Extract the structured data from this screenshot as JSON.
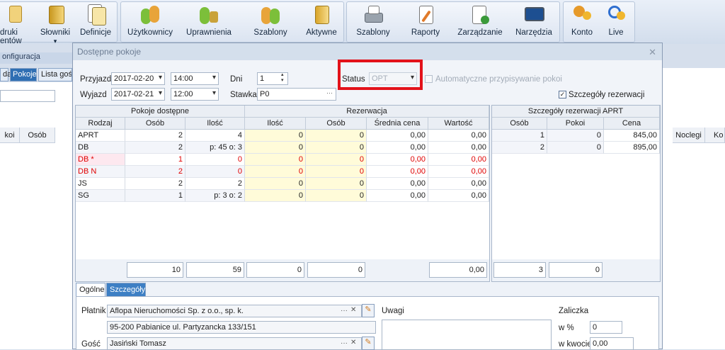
{
  "ribbon": {
    "items": [
      {
        "label": "druki\nentów",
        "name": "druki-button"
      },
      {
        "label": "Słowniki",
        "name": "slowniki-button"
      },
      {
        "label": "Definicje",
        "name": "definicje-button"
      },
      {
        "label": "Użytkownicy",
        "name": "uzytkownicy-button"
      },
      {
        "label": "Uprawnienia",
        "name": "uprawnienia-button"
      },
      {
        "label": "Szablony",
        "name": "szablony1-button"
      },
      {
        "label": "Aktywne",
        "name": "aktywne-button"
      },
      {
        "label": "Szablony",
        "name": "szablony2-button"
      },
      {
        "label": "Raporty",
        "name": "raporty-button"
      },
      {
        "label": "Zarządzanie",
        "name": "zarzadzanie-button"
      },
      {
        "label": "Narzędzia",
        "name": "narzedzia-button"
      },
      {
        "label": "Konto",
        "name": "konto-button"
      },
      {
        "label": "Live",
        "name": "live-button"
      }
    ],
    "config_label": "onfiguracja"
  },
  "left": {
    "tabs": [
      "da",
      "Pokoje",
      "Lista gośc"
    ],
    "col1": "koi",
    "col2": "Osób",
    "right_cols": [
      "Noclegi",
      "Ko"
    ]
  },
  "dialog": {
    "title": "Dostępne pokoje",
    "arrival_label": "Przyjazd",
    "arrival_date": "2017-02-20",
    "arrival_time": "14:00",
    "departure_label": "Wyjazd",
    "departure_date": "2017-02-21",
    "departure_time": "12:00",
    "days_label": "Dni",
    "days_value": "1",
    "rate_label": "Stawka",
    "rate_value": "P0",
    "status_label": "Status",
    "status_value": "OPT",
    "auto_assign_label": "Automatyczne przypisywanie pokoi",
    "details_label": "Szczegóły rezerwacji"
  },
  "rooms": {
    "group_title": "Pokoje dostępne",
    "res_title": "Rezerwacja",
    "headers": [
      "Rodzaj",
      "Osób",
      "Ilość",
      "Ilość",
      "Osób",
      "Średnia cena",
      "Wartość"
    ],
    "rows": [
      {
        "type": "APRT",
        "persons": "2",
        "qty": "4",
        "rq": "0",
        "rp": "0",
        "avg": "0,00",
        "val": "0,00",
        "color": "#1e1e1e"
      },
      {
        "type": "DB",
        "persons": "2",
        "qty": "p: 45 o: 3",
        "rq": "0",
        "rp": "0",
        "avg": "0,00",
        "val": "0,00",
        "color": "#1e1e1e"
      },
      {
        "type": "DB *",
        "persons": "1",
        "qty": "0",
        "rq": "0",
        "rp": "0",
        "avg": "0,00",
        "val": "0,00",
        "color": "#e00000"
      },
      {
        "type": "DB N",
        "persons": "2",
        "qty": "0",
        "rq": "0",
        "rp": "0",
        "avg": "0,00",
        "val": "0,00",
        "color": "#e00000"
      },
      {
        "type": "JS",
        "persons": "2",
        "qty": "2",
        "rq": "0",
        "rp": "0",
        "avg": "0,00",
        "val": "0,00",
        "color": "#1e1e1e"
      },
      {
        "type": "SG",
        "persons": "1",
        "qty": "p: 3 o: 2",
        "rq": "0",
        "rp": "0",
        "avg": "0,00",
        "val": "0,00",
        "color": "#1e1e1e"
      }
    ],
    "totals": {
      "persons": "10",
      "qty": "59",
      "rq": "0",
      "rp": "0",
      "val": "0,00"
    }
  },
  "details": {
    "title": "Szczegóły rezerwacji APRT",
    "headers": [
      "Osób",
      "Pokoi",
      "Cena"
    ],
    "rows": [
      {
        "p": "1",
        "r": "0",
        "c": "845,00"
      },
      {
        "p": "2",
        "r": "0",
        "c": "895,00"
      }
    ],
    "totals": {
      "p": "3",
      "r": "0"
    }
  },
  "bottom": {
    "tabs": [
      "Ogólne",
      "Szczegóły"
    ],
    "payer_label": "Płatnik",
    "payer_value": "Aflopa Nieruchomości Sp. z o.o., sp. k.",
    "address_value": "95-200 Pabianice ul. Partyzancka 133/151",
    "guest_label": "Gość",
    "guest_value": "Jasiński Tomasz",
    "notes_label": "Uwagi",
    "advance_label": "Zaliczka",
    "pct_label": "w %",
    "pct_value": "0",
    "amount_label": "w kwocie",
    "amount_value": "0,00"
  },
  "colors": {
    "highlight": "#e3121a",
    "yellow": "#fffbd9",
    "pink": "#fde8ef"
  }
}
